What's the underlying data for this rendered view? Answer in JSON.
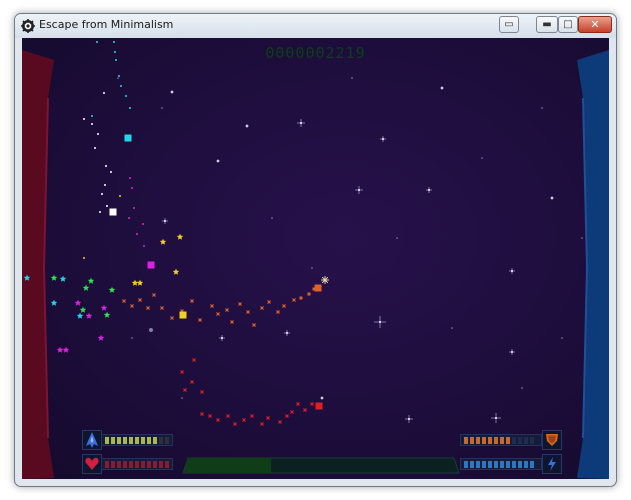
{
  "window": {
    "title": "Escape from Minimalism",
    "app_icon": "gear-icon",
    "controls": {
      "extra_icon": "window-extra-icon",
      "minimize_icon": "minimize-icon",
      "maximize_icon": "maximize-icon",
      "close_icon": "close-icon"
    }
  },
  "game": {
    "score": "0000002219",
    "colors": {
      "score": "#0d3f16",
      "left_wall": "#5a0a20",
      "right_wall": "#0d3a78",
      "cyan": "#22d8e8",
      "white": "#ffffff",
      "magenta": "#e020e0",
      "yellow": "#f0d020",
      "green": "#30e050",
      "orange": "#e0602a",
      "red": "#e02020"
    },
    "hud": {
      "ship_icon": "ship-icon",
      "heart_icon": "heart-icon",
      "shield_icon": "shield-icon",
      "lightning_icon": "lightning-icon",
      "ship_bar_level": 0.82,
      "heart_bar_level": 1.0,
      "shield_bar_level": 0.7,
      "lightning_bar_level": 1.0,
      "progress_level": 0.32
    }
  }
}
